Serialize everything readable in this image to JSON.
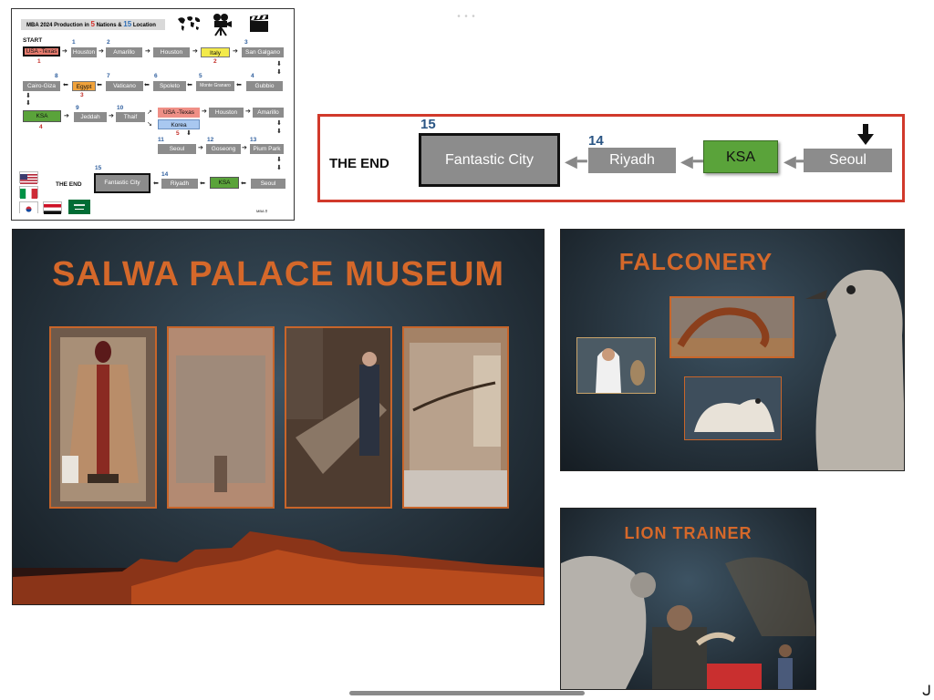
{
  "map_slide": {
    "header_prefix": "MBA 2024   Production in",
    "header_nations_count": "5",
    "header_mid": "Nations &",
    "header_locations_count": "15",
    "header_suffix": "Location",
    "start_label": "START",
    "the_end_label": "THE END",
    "footer_mark": "MBA ⚲",
    "nodes": {
      "usa_texas": "USA -Texas",
      "houston1": "Houston",
      "amarillo1": "Amarillo",
      "houston2": "Houston",
      "italy": "Italy",
      "san_galgano": "San Galgano",
      "gubbio": "Gubbio",
      "monte_granaro": "Monte Granaro",
      "spoleto": "Spoleto",
      "vaticano": "Vaticano",
      "egypt": "Egypt",
      "cairo_giza": "Cairo-Giza",
      "ksa": "KSA",
      "jeddah": "Jeddah",
      "thaif": "Thaif",
      "usa_texas2": "USA -Texas",
      "korea": "Korea",
      "houston3": "Houston",
      "amarillo2": "Amarillo",
      "seoul1": "Seoul",
      "goseong": "Goseong",
      "pium_park": "Pium Park",
      "seoul2": "Seoul",
      "ksa2": "KSA",
      "riyadh": "Riyadh",
      "fantastic_city": "Fantastic City"
    },
    "numbers": {
      "n1": "1",
      "n1r": "1",
      "n2": "2",
      "n2r": "2",
      "n3": "3",
      "n4": "4",
      "n5": "5",
      "n6": "6",
      "n7": "7",
      "n8": "8",
      "n3r": "3",
      "n9": "9",
      "n10": "10",
      "n4r": "4",
      "n5r": "5",
      "n11": "11",
      "n12": "12",
      "n13": "13",
      "n14": "14",
      "n15": "15"
    },
    "flags": [
      "usa-flag",
      "italy-flag",
      "korea-flag",
      "egypt-flag",
      "saudi-flag"
    ],
    "icons": [
      "world-map-icon",
      "movie-camera-icon",
      "clapperboard-icon"
    ]
  },
  "zoom_box": {
    "the_end": "THE END",
    "fantastic_city": "Fantastic City",
    "fantastic_city_num": "15",
    "riyadh": "Riyadh",
    "riyadh_num": "14",
    "ksa": "KSA",
    "seoul": "Seoul"
  },
  "museum_slide": {
    "title": "SALWA PALACE MUSEUM"
  },
  "falconery_slide": {
    "title": "FALCONERY"
  },
  "lion_slide": {
    "title": "LION TRAINER"
  },
  "colors": {
    "accent_orange": "#d5682a",
    "highlight_red": "#d1392b",
    "node_gray": "#8c8c8c",
    "ksa_green": "#5aa33a",
    "number_blue": "#2a5584"
  }
}
